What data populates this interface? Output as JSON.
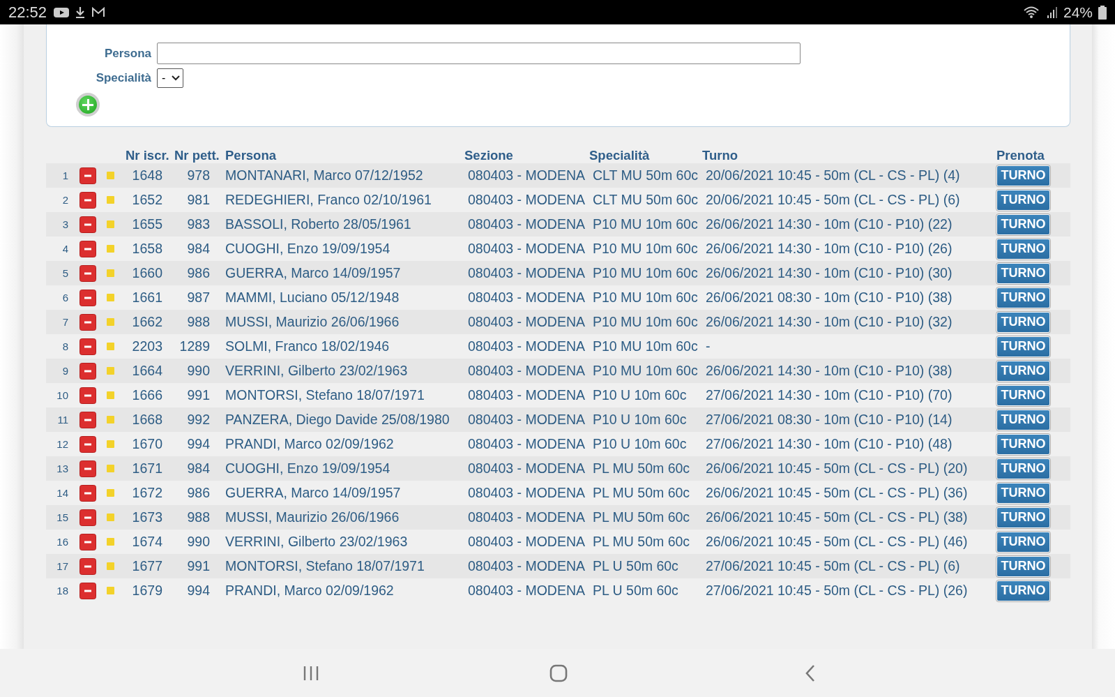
{
  "status_bar": {
    "time": "22:52",
    "battery": "24%"
  },
  "form": {
    "persona_field": {
      "label": "Persona"
    },
    "specialita_field": {
      "label": "Specialità",
      "value": "-"
    }
  },
  "table": {
    "columns": [
      "Nr iscr.",
      "Nr pett.",
      "Persona",
      "Sezione",
      "Specialità",
      "Turno",
      "Prenota"
    ],
    "rows": [
      {
        "index": "1",
        "nr_iscr": "1648",
        "nr_pett": "978",
        "persona": "MONTANARI, Marco 07/12/1952",
        "sezione": "080403 - MODENA",
        "specialita": "CLT MU 50m 60c",
        "turno": "20/06/2021 10:45 - 50m (CL - CS - PL) (4)",
        "button": "TURNO"
      },
      {
        "index": "2",
        "nr_iscr": "1652",
        "nr_pett": "981",
        "persona": "REDEGHIERI, Franco 02/10/1961",
        "sezione": "080403 - MODENA",
        "specialita": "CLT MU 50m 60c",
        "turno": "20/06/2021 10:45 - 50m (CL - CS - PL) (6)",
        "button": "TURNO"
      },
      {
        "index": "3",
        "nr_iscr": "1655",
        "nr_pett": "983",
        "persona": "BASSOLI, Roberto 28/05/1961",
        "sezione": "080403 - MODENA",
        "specialita": "P10 MU 10m 60c",
        "turno": "26/06/2021 14:30 - 10m (C10 - P10) (22)",
        "button": "TURNO"
      },
      {
        "index": "4",
        "nr_iscr": "1658",
        "nr_pett": "984",
        "persona": "CUOGHI, Enzo 19/09/1954",
        "sezione": "080403 - MODENA",
        "specialita": "P10 MU 10m 60c",
        "turno": "26/06/2021 14:30 - 10m (C10 - P10) (26)",
        "button": "TURNO"
      },
      {
        "index": "5",
        "nr_iscr": "1660",
        "nr_pett": "986",
        "persona": "GUERRA, Marco 14/09/1957",
        "sezione": "080403 - MODENA",
        "specialita": "P10 MU 10m 60c",
        "turno": "26/06/2021 14:30 - 10m (C10 - P10) (30)",
        "button": "TURNO"
      },
      {
        "index": "6",
        "nr_iscr": "1661",
        "nr_pett": "987",
        "persona": "MAMMI, Luciano 05/12/1948",
        "sezione": "080403 - MODENA",
        "specialita": "P10 MU 10m 60c",
        "turno": "26/06/2021 08:30 - 10m (C10 - P10) (38)",
        "button": "TURNO"
      },
      {
        "index": "7",
        "nr_iscr": "1662",
        "nr_pett": "988",
        "persona": "MUSSI, Maurizio 26/06/1966",
        "sezione": "080403 - MODENA",
        "specialita": "P10 MU 10m 60c",
        "turno": "26/06/2021 14:30 - 10m (C10 - P10) (32)",
        "button": "TURNO"
      },
      {
        "index": "8",
        "nr_iscr": "2203",
        "nr_pett": "1289",
        "persona": "SOLMI, Franco 18/02/1946",
        "sezione": "080403 - MODENA",
        "specialita": "P10 MU 10m 60c",
        "turno": "-",
        "button": "TURNO"
      },
      {
        "index": "9",
        "nr_iscr": "1664",
        "nr_pett": "990",
        "persona": "VERRINI, Gilberto 23/02/1963",
        "sezione": "080403 - MODENA",
        "specialita": "P10 MU 10m 60c",
        "turno": "26/06/2021 14:30 - 10m (C10 - P10) (38)",
        "button": "TURNO"
      },
      {
        "index": "10",
        "nr_iscr": "1666",
        "nr_pett": "991",
        "persona": "MONTORSI, Stefano 18/07/1971",
        "sezione": "080403 - MODENA",
        "specialita": "P10 U 10m 60c",
        "turno": "27/06/2021 14:30 - 10m (C10 - P10) (70)",
        "button": "TURNO"
      },
      {
        "index": "11",
        "nr_iscr": "1668",
        "nr_pett": "992",
        "persona": "PANZERA, Diego Davide 25/08/1980",
        "sezione": "080403 - MODENA",
        "specialita": "P10 U 10m 60c",
        "turno": "27/06/2021 08:30 - 10m (C10 - P10) (14)",
        "button": "TURNO"
      },
      {
        "index": "12",
        "nr_iscr": "1670",
        "nr_pett": "994",
        "persona": "PRANDI, Marco 02/09/1962",
        "sezione": "080403 - MODENA",
        "specialita": "P10 U 10m 60c",
        "turno": "27/06/2021 14:30 - 10m (C10 - P10) (48)",
        "button": "TURNO"
      },
      {
        "index": "13",
        "nr_iscr": "1671",
        "nr_pett": "984",
        "persona": "CUOGHI, Enzo 19/09/1954",
        "sezione": "080403 - MODENA",
        "specialita": "PL MU 50m 60c",
        "turno": "26/06/2021 10:45 - 50m (CL - CS - PL) (20)",
        "button": "TURNO"
      },
      {
        "index": "14",
        "nr_iscr": "1672",
        "nr_pett": "986",
        "persona": "GUERRA, Marco 14/09/1957",
        "sezione": "080403 - MODENA",
        "specialita": "PL MU 50m 60c",
        "turno": "26/06/2021 10:45 - 50m (CL - CS - PL) (36)",
        "button": "TURNO"
      },
      {
        "index": "15",
        "nr_iscr": "1673",
        "nr_pett": "988",
        "persona": "MUSSI, Maurizio 26/06/1966",
        "sezione": "080403 - MODENA",
        "specialita": "PL MU 50m 60c",
        "turno": "26/06/2021 10:45 - 50m (CL - CS - PL) (38)",
        "button": "TURNO"
      },
      {
        "index": "16",
        "nr_iscr": "1674",
        "nr_pett": "990",
        "persona": "VERRINI, Gilberto 23/02/1963",
        "sezione": "080403 - MODENA",
        "specialita": "PL MU 50m 60c",
        "turno": "26/06/2021 10:45 - 50m (CL - CS - PL) (46)",
        "button": "TURNO"
      },
      {
        "index": "17",
        "nr_iscr": "1677",
        "nr_pett": "991",
        "persona": "MONTORSI, Stefano 18/07/1971",
        "sezione": "080403 - MODENA",
        "specialita": "PL U 50m 60c",
        "turno": "27/06/2021 10:45 - 50m (CL - CS - PL) (6)",
        "button": "TURNO"
      },
      {
        "index": "18",
        "nr_iscr": "1679",
        "nr_pett": "994",
        "persona": "PRANDI, Marco 02/09/1962",
        "sezione": "080403 - MODENA",
        "specialita": "PL U 50m 60c",
        "turno": "27/06/2021 10:45 - 50m (CL - CS - PL) (26)",
        "button": "TURNO"
      }
    ]
  }
}
